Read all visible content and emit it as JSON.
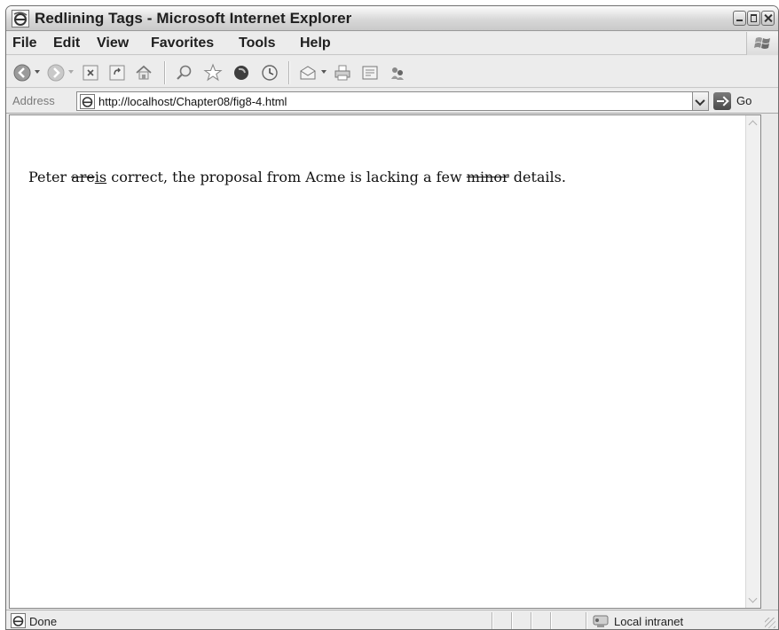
{
  "window": {
    "title": "Redlining Tags - Microsoft Internet Explorer"
  },
  "menu": {
    "items": [
      "File",
      "Edit",
      "View",
      "Favorites",
      "Tools",
      "Help"
    ]
  },
  "toolbar": {
    "buttons": [
      "back-icon",
      "forward-icon",
      "stop-icon",
      "refresh-icon",
      "home-icon",
      "search-icon",
      "favorites-icon",
      "media-icon",
      "history-icon",
      "mail-icon",
      "print-icon",
      "edit-icon",
      "messenger-icon"
    ]
  },
  "address": {
    "label": "Address",
    "url": "http://localhost/Chapter08/fig8-4.html",
    "go_label": "Go"
  },
  "document": {
    "before": "Peter ",
    "deleted_1": "are",
    "inserted_1": "is",
    "middle": " correct, the proposal from Acme is lacking a few ",
    "deleted_2": "minor",
    "after": " details."
  },
  "status": {
    "text": "Done",
    "zone": "Local intranet"
  }
}
